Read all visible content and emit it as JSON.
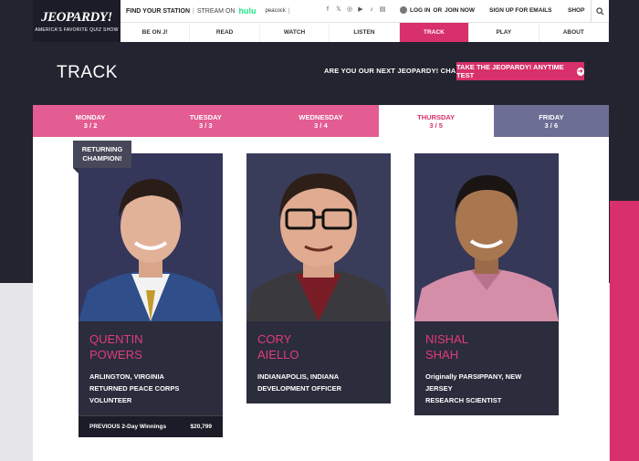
{
  "brand": {
    "logo": "JEOPARDY!",
    "tagline": "AMERICA'S FAVORITE QUIZ SHOW"
  },
  "topbar": {
    "find_station": "FIND YOUR STATION",
    "stream_on": "STREAM ON",
    "hulu": "hulu",
    "peacock": "peacock",
    "socials": [
      "facebook-icon",
      "x-icon",
      "instagram-icon",
      "youtube-icon",
      "tiktok-icon",
      "reader-icon"
    ],
    "login": "LOG IN",
    "or": "OR",
    "join": "JOIN NOW",
    "signup": "SIGN UP FOR EMAILS",
    "shop": "SHOP"
  },
  "nav": [
    {
      "label": "BE ON J!",
      "active": false
    },
    {
      "label": "READ",
      "active": false
    },
    {
      "label": "WATCH",
      "active": false
    },
    {
      "label": "LISTEN",
      "active": false
    },
    {
      "label": "TRACK",
      "active": true
    },
    {
      "label": "PLAY",
      "active": false
    },
    {
      "label": "ABOUT",
      "active": false
    }
  ],
  "page": {
    "title": "TRACK",
    "champion_question": "ARE YOU OUR NEXT JEOPARDY! CHAMPION?",
    "test_button": "TAKE THE JEOPARDY! ANYTIME TEST"
  },
  "days": [
    {
      "day": "MONDAY",
      "date": "3 / 2"
    },
    {
      "day": "TUESDAY",
      "date": "3 / 3"
    },
    {
      "day": "WEDNESDAY",
      "date": "3 / 4"
    },
    {
      "day": "THURSDAY",
      "date": "3 / 5"
    },
    {
      "day": "FRIDAY",
      "date": "3 / 6"
    }
  ],
  "badge": {
    "line1": "RETURNING",
    "line2": "CHAMPION!"
  },
  "contestants": [
    {
      "first": "QUENTIN",
      "last": "POWERS",
      "hometown": "ARLINGTON, VIRGINIA",
      "job": "RETURNED PEACE CORPS VOLUNTEER",
      "winnings_label": "PREVIOUS 2-Day Winnings",
      "winnings_value": "$20,799"
    },
    {
      "first": "CORY",
      "last": "AIELLO",
      "hometown": "INDIANAPOLIS, INDIANA",
      "job": "DEVELOPMENT OFFICER"
    },
    {
      "first": "NISHAL",
      "last": "SHAH",
      "hometown": "Originally PARSIPPANY, NEW JERSEY",
      "job": "RESEARCH SCIENTIST"
    }
  ],
  "colors": {
    "accent": "#d8306a",
    "dark": "#23242f",
    "card": "#2b2c3c"
  }
}
